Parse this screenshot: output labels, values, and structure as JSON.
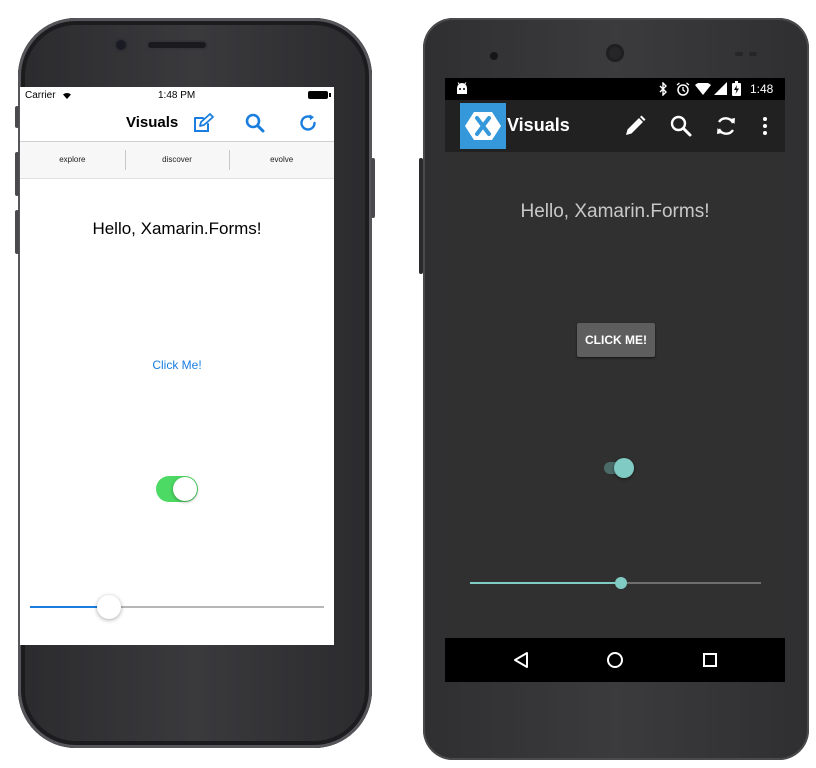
{
  "ios": {
    "status": {
      "carrier": "Carrier",
      "time": "1:48 PM"
    },
    "nav": {
      "title": "Visuals",
      "icons": [
        "compose-icon",
        "search-icon",
        "refresh-icon"
      ]
    },
    "tabs": [
      {
        "label": "explore"
      },
      {
        "label": "discover"
      },
      {
        "label": "evolve"
      }
    ],
    "content": {
      "label_text": "Hello, Xamarin.Forms!",
      "button_label": "Click Me!",
      "switch_on": true,
      "slider_value": 0.27
    },
    "colors": {
      "tint": "#1a7ee0",
      "switch_on": "#4cd964"
    }
  },
  "android": {
    "status": {
      "time": "1:48"
    },
    "toolbar": {
      "title": "Visuals",
      "icons": [
        "xamarin-logo-icon",
        "pencil-icon",
        "search-icon",
        "refresh-icon",
        "overflow-menu-icon"
      ]
    },
    "content": {
      "label_text": "Hello, Xamarin.Forms!",
      "button_label": "CLICK ME!",
      "switch_on": true,
      "slider_value": 0.52
    },
    "colors": {
      "accent": "#80cbc4",
      "logo_blue": "#3498db"
    }
  }
}
